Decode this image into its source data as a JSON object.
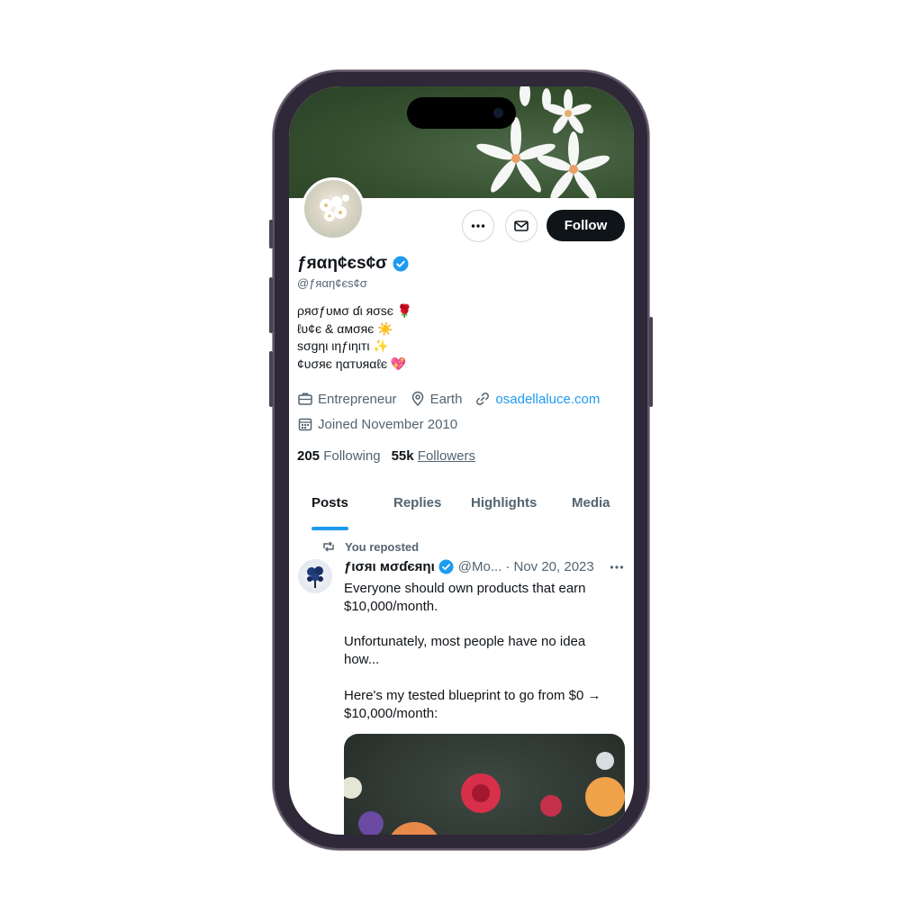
{
  "header": {
    "follow_label": "Follow"
  },
  "profile": {
    "display_name": "ƒяαη¢єѕ¢σ",
    "handle": "@ƒяαη¢єѕ¢σ",
    "bio_lines": [
      "ρяσƒυмσ ɗι яσѕє 🌹",
      "ℓυ¢є & αмσяє ☀️",
      "ѕσgηι ιηƒιηιтι ✨",
      "¢υσяє ηαтυяαℓє 💖"
    ],
    "occupation": "Entrepreneur",
    "location": "Earth",
    "website": "osadellaluce.com",
    "joined": "Joined November 2010",
    "following_count": "205",
    "following_label": "Following",
    "followers_count": "55k",
    "followers_label": "Followers"
  },
  "tabs": [
    "Posts",
    "Replies",
    "Highlights",
    "Media"
  ],
  "feed": {
    "repost_label": "You reposted",
    "tweet": {
      "author_name": "ƒισяι мσɗєяηι",
      "author_handle": "@Mo...",
      "date": "· Nov 20, 2023",
      "paragraphs": [
        "Everyone should own products that earn $10,000/month.",
        "Unfortunately, most people have no idea how...",
        "Here's my tested blueprint to go from $0 → $10,000/month:"
      ]
    }
  },
  "icons": {
    "more": "more-horizontal-icon",
    "message": "envelope-icon",
    "verified": "verified-badge-icon",
    "briefcase": "briefcase-icon",
    "location": "location-pin-icon",
    "link": "link-icon",
    "calendar": "calendar-icon",
    "repost": "repost-icon"
  },
  "colors": {
    "accent": "#1d9bf0",
    "text_primary": "#0f1419",
    "text_secondary": "#536471",
    "follow_button": "#0f1419"
  }
}
